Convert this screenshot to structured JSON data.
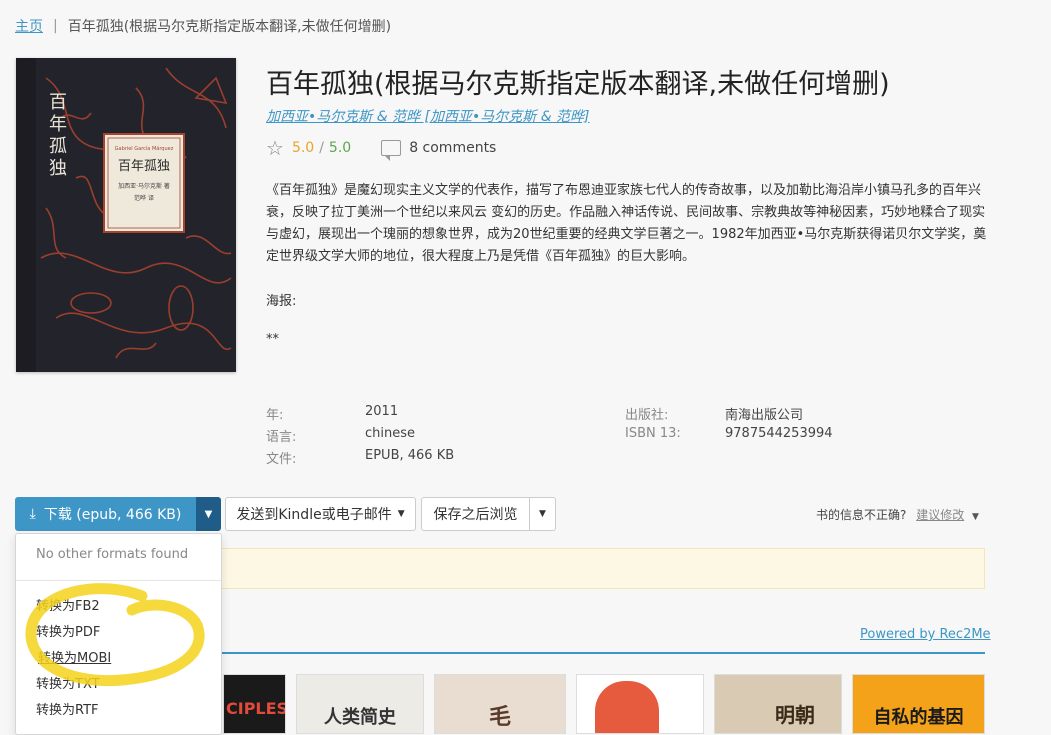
{
  "breadcrumb": {
    "home": "主页",
    "sep": "|",
    "current": "百年孤独(根据马尔克斯指定版本翻译,未做任何增删)"
  },
  "cover": {
    "author_en": "Gabriel García Márquez",
    "title_cn": "百年孤独",
    "author_cn": "加西亚·马尔克斯 著",
    "translator": "范晔 译",
    "spine_title": "百年孤独"
  },
  "book": {
    "title": "百年孤独(根据马尔克斯指定版本翻译,未做任何增删)",
    "author": "加西亚•马尔克斯 & 范晔 [加西亚•马尔克斯 & 范晔]",
    "rating": "5.0",
    "rating_sep": "/",
    "rating_max": "5.0",
    "comments": "8 comments",
    "description": "《百年孤独》是魔幻现实主义文学的代表作，描写了布恩迪亚家族七代人的传奇故事，以及加勒比海沿岸小镇马孔多的百年兴衰，反映了拉丁美洲一个世纪以来风云 变幻的历史。作品融入神话传说、民间故事、宗教典故等神秘因素，巧妙地糅合了现实与虚幻，展现出一个瑰丽的想象世界，成为20世纪重要的经典文学巨著之一。1982年加西亚•马尔克斯获得诺贝尔文学奖，奠定世界级文学大师的地位，很大程度上乃是凭借《百年孤独》的巨大影响。",
    "poster_label": "海报:",
    "stars": "**"
  },
  "details": {
    "year_label": "年:",
    "year": "2011",
    "lang_label": "语言:",
    "lang": "chinese",
    "file_label": "文件:",
    "file": "EPUB, 466 KB",
    "publisher_label": "出版社:",
    "publisher": "南海出版公司",
    "isbn_label": "ISBN 13:",
    "isbn": "9787544253994"
  },
  "toolbar": {
    "download": "下载 (epub, 466 KB)",
    "send": "发送到Kindle或电子邮件",
    "save": "保存之后浏览",
    "incorrect": "书的信息不正确?",
    "suggest": "建议修改"
  },
  "dropdown": {
    "none": "No other formats found",
    "options": [
      "转换为FB2",
      "转换为PDF",
      "转换为MOBI",
      "转换为TXT",
      "转换为RTF"
    ]
  },
  "recommend": {
    "powered": "Powered by Rec2Me",
    "thumbs": [
      "CIPLES",
      "人类简史",
      "毛",
      "",
      "",
      "明朝",
      "自私的基因"
    ]
  },
  "colors": {
    "accent": "#3e96c6",
    "rating": "#e8a42a",
    "rating_max": "#5aa84c",
    "highlight": "#f5d21a"
  }
}
